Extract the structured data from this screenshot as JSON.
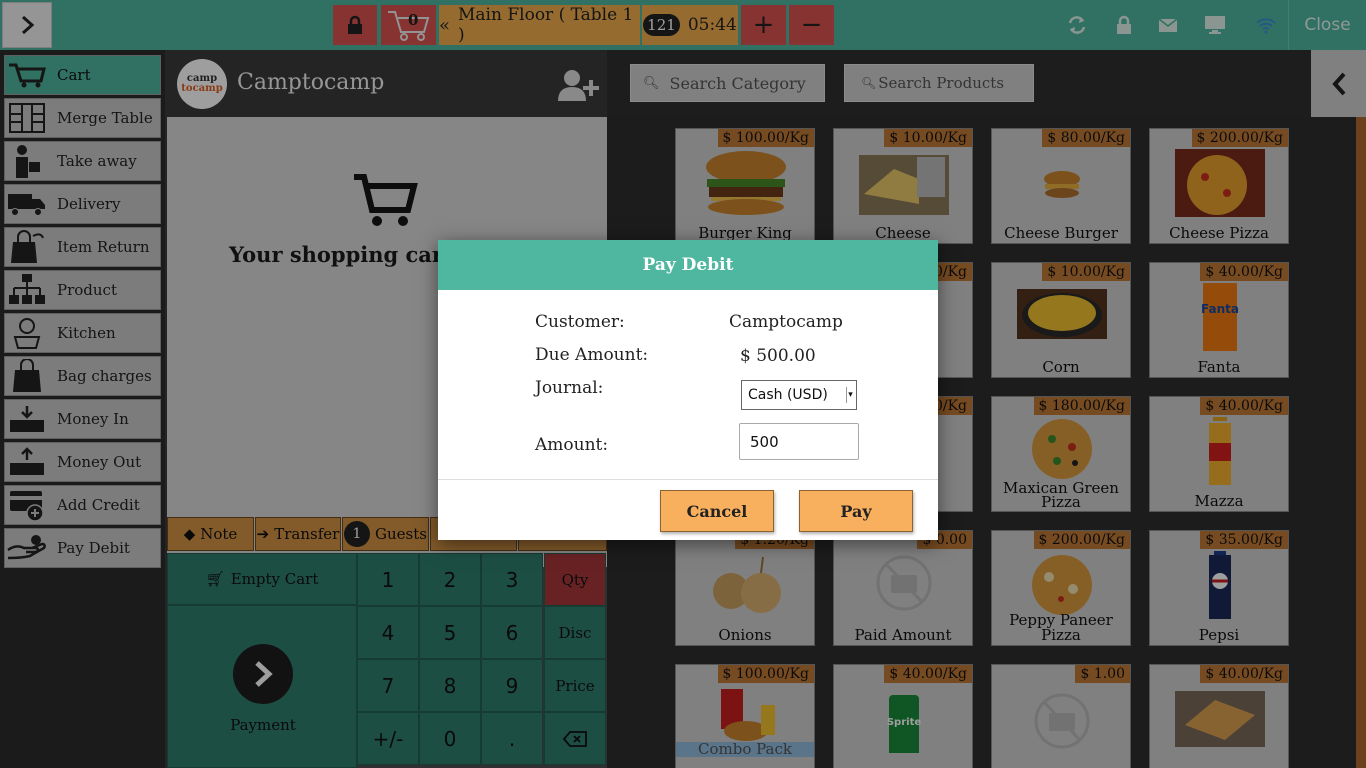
{
  "topbar": {
    "cart_count": "0",
    "floor_label": "Main Floor ( Table 1 )",
    "order_number": "121",
    "time": "05:44",
    "plus": "+",
    "minus": "−",
    "close": "Close"
  },
  "menu": {
    "items": [
      {
        "label": "Cart",
        "icon": "cart-icon"
      },
      {
        "label": "Merge Table",
        "icon": "merge-table-icon"
      },
      {
        "label": "Take away",
        "icon": "take-away-icon"
      },
      {
        "label": "Delivery",
        "icon": "delivery-truck-icon"
      },
      {
        "label": "Item Return",
        "icon": "item-return-icon"
      },
      {
        "label": "Product",
        "icon": "product-icon"
      },
      {
        "label": "Kitchen",
        "icon": "kitchen-icon"
      },
      {
        "label": "Bag charges",
        "icon": "bag-icon"
      },
      {
        "label": "Money In",
        "icon": "money-in-icon"
      },
      {
        "label": "Money Out",
        "icon": "money-out-icon"
      },
      {
        "label": "Add Credit",
        "icon": "add-credit-icon"
      },
      {
        "label": "Pay Debit",
        "icon": "pay-debit-icon"
      }
    ]
  },
  "order": {
    "customer_logo_line1": "camp",
    "customer_logo_line2": "tocamp",
    "customer_name": "Camptocamp",
    "cart_empty": "Your shopping cart",
    "actions": {
      "note": "Note",
      "transfer": "Transfer",
      "guests_count": "1",
      "guests": "Guests"
    },
    "pad": {
      "empty_cart": "Empty Cart",
      "payment": "Payment",
      "keys": [
        "1",
        "2",
        "3",
        "4",
        "5",
        "6",
        "7",
        "8",
        "9",
        "+/-",
        "0",
        "."
      ],
      "modes": [
        "Qty",
        "Disc",
        "Price"
      ]
    }
  },
  "products": {
    "search_category": "Search Category",
    "search_products": "Search Products",
    "items": [
      {
        "name": "Burger King",
        "price": "$ 100.00/Kg"
      },
      {
        "name": "Cheese",
        "price": "$ 10.00/Kg"
      },
      {
        "name": "Cheese Burger",
        "price": "$ 80.00/Kg"
      },
      {
        "name": "Cheese Pizza",
        "price": "$ 200.00/Kg"
      },
      {
        "name": "",
        "price": "0/Kg"
      },
      {
        "name": "Corn",
        "price": "$ 10.00/Kg"
      },
      {
        "name": "Fanta",
        "price": "$ 40.00/Kg"
      },
      {
        "name": "",
        "price": "0/Kg"
      },
      {
        "name": "Maxican Green Pizza",
        "price": "$ 180.00/Kg"
      },
      {
        "name": "Mazza",
        "price": "$ 40.00/Kg"
      },
      {
        "name": "Onions",
        "price": "$ 1.20/Kg"
      },
      {
        "name": "Paid Amount",
        "price": "$ 0.00"
      },
      {
        "name": "Peppy Paneer Pizza",
        "price": "$ 200.00/Kg"
      },
      {
        "name": "Pepsi",
        "price": "$ 35.00/Kg"
      },
      {
        "name": "Combo Pack",
        "price": "$ 100.00/Kg"
      },
      {
        "name": "",
        "price": "$ 40.00/Kg"
      },
      {
        "name": "",
        "price": "$ 1.00"
      },
      {
        "name": "",
        "price": "$ 40.00/Kg"
      }
    ]
  },
  "dialog": {
    "title": "Pay Debit",
    "customer_label": "Customer:",
    "customer_value": "Camptocamp",
    "due_label": "Due Amount:",
    "due_value": "$ 500.00",
    "journal_label": "Journal:",
    "journal_value": "Cash (USD)",
    "amount_label": "Amount:",
    "amount_value": "500",
    "cancel": "Cancel",
    "pay": "Pay"
  },
  "colors": {
    "teal": "#4fb7a0",
    "orange": "#f9b05e",
    "red": "#d9534f"
  }
}
